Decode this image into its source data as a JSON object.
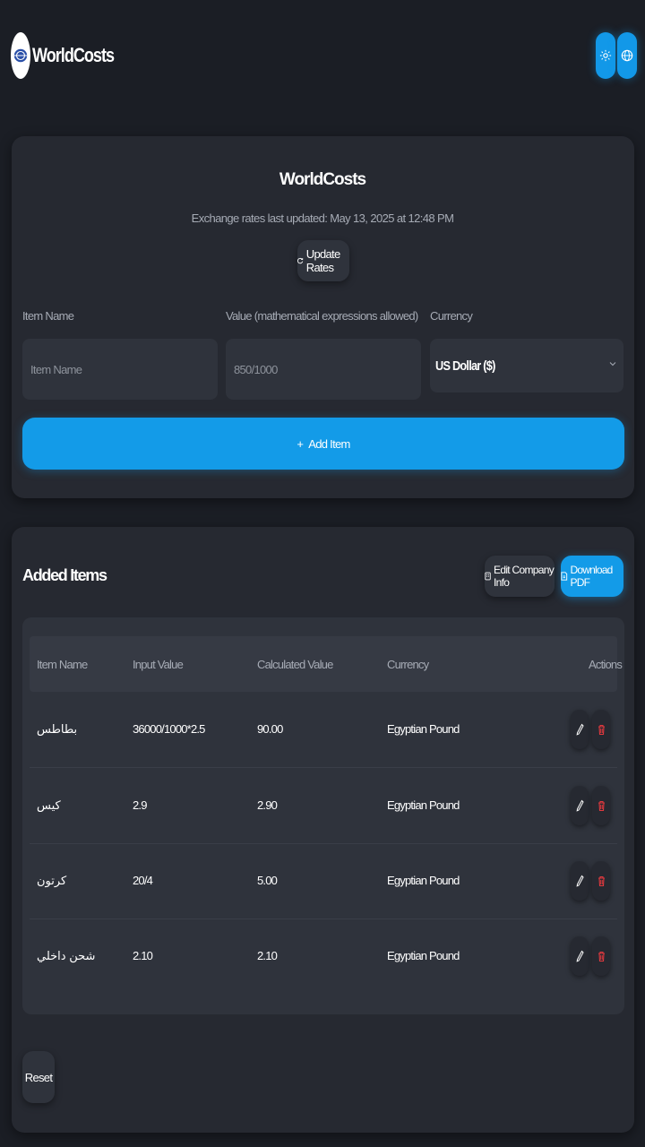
{
  "header": {
    "brand": "WorldCosts",
    "logo_icon": "globe-logo",
    "theme_icon": "sun-icon",
    "language_icon": "globe-icon",
    "accent": "#1298e8"
  },
  "converter": {
    "title": "WorldCosts",
    "rates_updated": "Exchange rates last updated: May 13, 2025 at 12:48 PM",
    "update_label": "Update Rates",
    "item_name_label": "Item Name",
    "item_name_placeholder": "Item Name",
    "value_label": "Value (mathematical expressions allowed)",
    "value_placeholder": "850/1000",
    "currency_label": "Currency",
    "currency_selected": "US Dollar ($)",
    "add_label": "Add Item"
  },
  "items": {
    "title": "Added Items",
    "edit_company_label": "Edit Company Info",
    "download_label": "Download PDF",
    "columns": [
      "Item Name",
      "Input Value",
      "Calculated Value",
      "Currency",
      "Actions"
    ],
    "rows": [
      {
        "name": "بطاطس",
        "input": "36000/1000*2.5",
        "calculated": "90.00",
        "currency": "Egyptian Pound"
      },
      {
        "name": "كيس",
        "input": "2.9",
        "calculated": "2.90",
        "currency": "Egyptian Pound"
      },
      {
        "name": "كرتون",
        "input": "20/4",
        "calculated": "5.00",
        "currency": "Egyptian Pound"
      },
      {
        "name": "شحن داخلي",
        "input": "2.10",
        "calculated": "2.10",
        "currency": "Egyptian Pound"
      }
    ],
    "delete_color": "#e0393e"
  },
  "footer": {
    "reset_label": "Reset"
  }
}
